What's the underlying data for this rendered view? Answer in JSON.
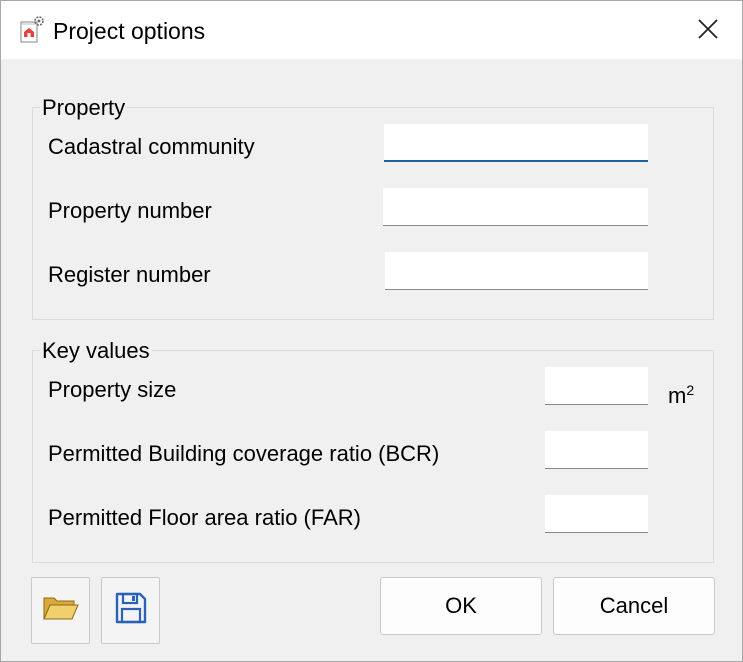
{
  "window": {
    "title": "Project options",
    "app_icon": "project-settings-icon",
    "close_icon": "close-icon"
  },
  "property_group": {
    "title": "Property",
    "fields": [
      {
        "label": "Cadastral community",
        "value": ""
      },
      {
        "label": "Property number",
        "value": ""
      },
      {
        "label": "Register number",
        "value": ""
      }
    ]
  },
  "key_values_group": {
    "title": "Key values",
    "fields": [
      {
        "label": "Property size",
        "value": "",
        "unit": "m",
        "unit_sup": "2"
      },
      {
        "label": "Permitted Building coverage ratio (BCR)",
        "value": ""
      },
      {
        "label": "Permitted Floor area ratio (FAR)",
        "value": ""
      }
    ]
  },
  "footer": {
    "open_icon": "folder-open-icon",
    "save_icon": "floppy-disk-icon",
    "ok_label": "OK",
    "cancel_label": "Cancel"
  },
  "colors": {
    "accent": "#1f5f9a",
    "dialog_bg": "#f0f0f0",
    "folder": "#e8c35a",
    "save": "#2a62b8"
  }
}
